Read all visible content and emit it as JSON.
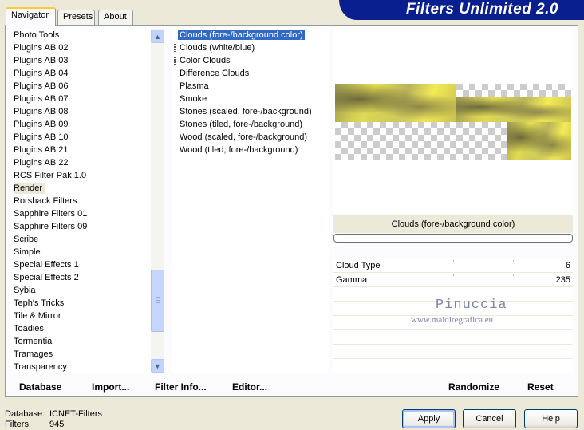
{
  "header": {
    "title": "Filters Unlimited 2.0"
  },
  "tabs": [
    {
      "label": "Navigator"
    },
    {
      "label": "Presets"
    },
    {
      "label": "About"
    }
  ],
  "categories": [
    "Photo Tools",
    "Plugins AB 02",
    "Plugins AB 03",
    "Plugins AB 04",
    "Plugins AB 06",
    "Plugins AB 07",
    "Plugins AB 08",
    "Plugins AB 09",
    "Plugins AB 10",
    "Plugins AB 21",
    "Plugins AB 22",
    "RCS Filter Pak 1.0",
    "Render",
    "Rorshack Filters",
    "Sapphire Filters 01",
    "Sapphire Filters 09",
    "Scribe",
    "Simple",
    "Special Effects 1",
    "Special Effects 2",
    "Sybia",
    "Teph's Tricks",
    "Tile & Mirror",
    "Toadies",
    "Tormentia",
    "Tramages",
    "Transparency"
  ],
  "filters": [
    "Clouds (fore-/background color)",
    "Clouds (white/blue)",
    "Color Clouds",
    "Difference Clouds",
    "Plasma",
    "Smoke",
    "Stones (scaled, fore-/background)",
    "Stones (tiled, fore-/background)",
    "Wood (scaled, fore-/background)",
    "Wood (tiled, fore-/background)"
  ],
  "preview": {
    "filter_title": "Clouds (fore-/background color)"
  },
  "params": [
    {
      "name": "Cloud Type",
      "value": "6"
    },
    {
      "name": "Gamma",
      "value": "235"
    }
  ],
  "watermark": {
    "line1": "Pinuccia",
    "line2": "www.maidiregrafica.eu"
  },
  "toolbar": {
    "database": "Database",
    "import": "Import...",
    "filter_info": "Filter Info...",
    "editor": "Editor...",
    "randomize": "Randomize",
    "reset": "Reset"
  },
  "footer": {
    "database_label": "Database:",
    "database_value": "ICNET-Filters",
    "filters_label": "Filters:",
    "filters_value": "945",
    "apply": "Apply",
    "cancel": "Cancel",
    "help": "Help"
  }
}
